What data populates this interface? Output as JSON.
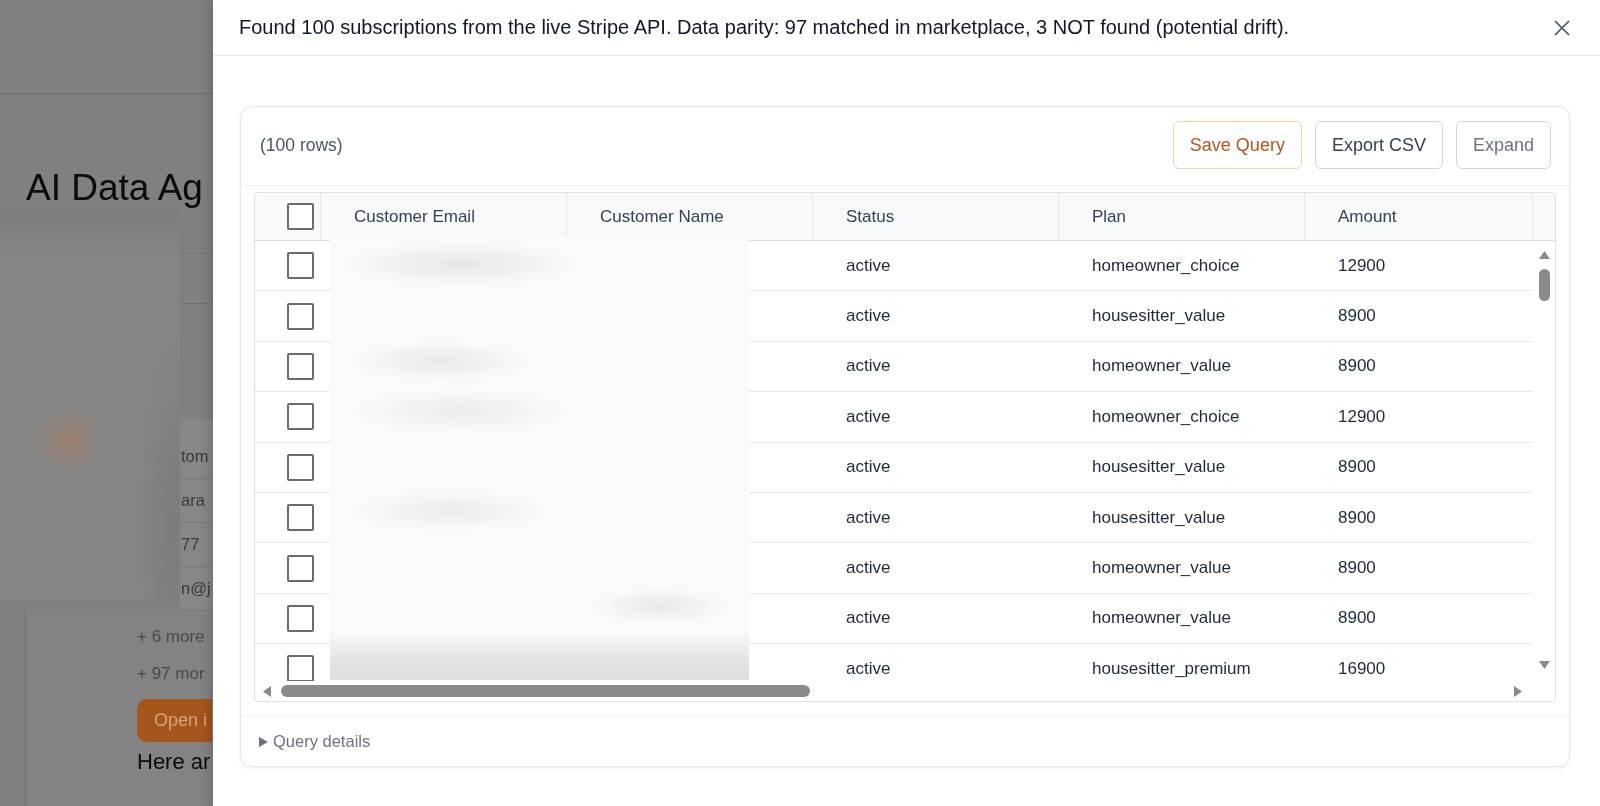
{
  "background_page": {
    "heading": "AI Data Ag",
    "list_fragments": [
      "tom",
      "ara",
      "77",
      "n@j"
    ],
    "more_notes": [
      "+ 6 more",
      "+ 97 mor"
    ],
    "button": "Open i",
    "message": "Here ar"
  },
  "panel": {
    "message": "Found 100 subscriptions from the live Stripe API. Data parity: 97 matched in marketplace, 3 NOT found (potential drift).",
    "row_count": "(100 rows)",
    "buttons": [
      {
        "label": "Save Query",
        "kind": "accent"
      },
      {
        "label": "Export CSV",
        "kind": "default"
      },
      {
        "label": "Expand",
        "kind": "subtle"
      }
    ],
    "table": {
      "select_all_checked": false,
      "columns": [
        "Customer Email",
        "Customer Name",
        "Status",
        "Plan",
        "Amount"
      ],
      "rows": [
        {
          "checked": false,
          "status": "active",
          "plan": "homeowner_choice",
          "amount": "12900"
        },
        {
          "checked": false,
          "status": "active",
          "plan": "housesitter_value",
          "amount": "8900"
        },
        {
          "checked": false,
          "status": "active",
          "plan": "homeowner_value",
          "amount": "8900"
        },
        {
          "checked": false,
          "status": "active",
          "plan": "homeowner_choice",
          "amount": "12900"
        },
        {
          "checked": false,
          "status": "active",
          "plan": "housesitter_value",
          "amount": "8900"
        },
        {
          "checked": false,
          "status": "active",
          "plan": "housesitter_value",
          "amount": "8900"
        },
        {
          "checked": false,
          "status": "active",
          "plan": "homeowner_value",
          "amount": "8900"
        },
        {
          "checked": false,
          "status": "active",
          "plan": "homeowner_value",
          "amount": "8900"
        },
        {
          "checked": false,
          "status": "active",
          "plan": "housesitter_premium",
          "amount": "16900"
        }
      ]
    },
    "query_details": {
      "label": "Query details",
      "expanded": false
    }
  }
}
